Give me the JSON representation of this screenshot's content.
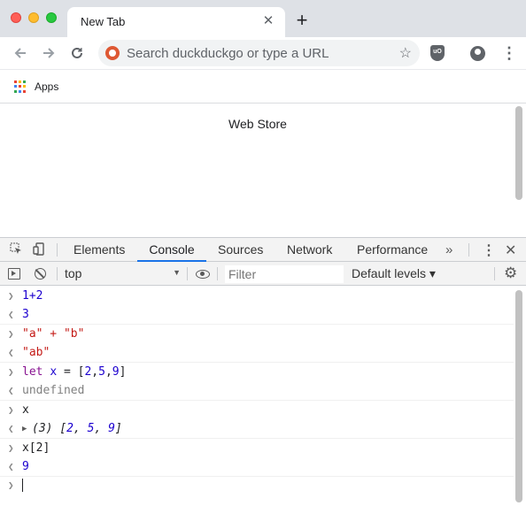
{
  "browser": {
    "tab_title": "New Tab",
    "tab_close": "✕",
    "new_tab": "+",
    "omnibox_placeholder": "Search duckduckgo or type a URL",
    "bookmarks": [
      {
        "label": "Apps"
      }
    ],
    "apps_colors": [
      "#ea4335",
      "#fbbc05",
      "#34a853",
      "#4285f4",
      "#ea4335",
      "#fbbc05",
      "#34a853",
      "#4285f4",
      "#ea4335"
    ],
    "ublock_label": "uO"
  },
  "page": {
    "link_text": "Web Store"
  },
  "devtools": {
    "tabs": [
      {
        "label": "Elements",
        "active": false
      },
      {
        "label": "Console",
        "active": true
      },
      {
        "label": "Sources",
        "active": false
      },
      {
        "label": "Network",
        "active": false
      },
      {
        "label": "Performance",
        "active": false
      }
    ],
    "more_tabs": "»",
    "context": "top",
    "filter_placeholder": "Filter",
    "levels": "Default levels ▾"
  },
  "console": {
    "entries": [
      {
        "input": "1+2",
        "output": "3"
      },
      {
        "input": "\"a\" + \"b\"",
        "output": "\"ab\""
      },
      {
        "input": "let x = [2,5,9]",
        "output": "undefined"
      },
      {
        "input": "x",
        "output": "(3) [2, 5, 9]"
      },
      {
        "input": "x[2]",
        "output": "9"
      }
    ],
    "accent": "#1a73e8"
  }
}
